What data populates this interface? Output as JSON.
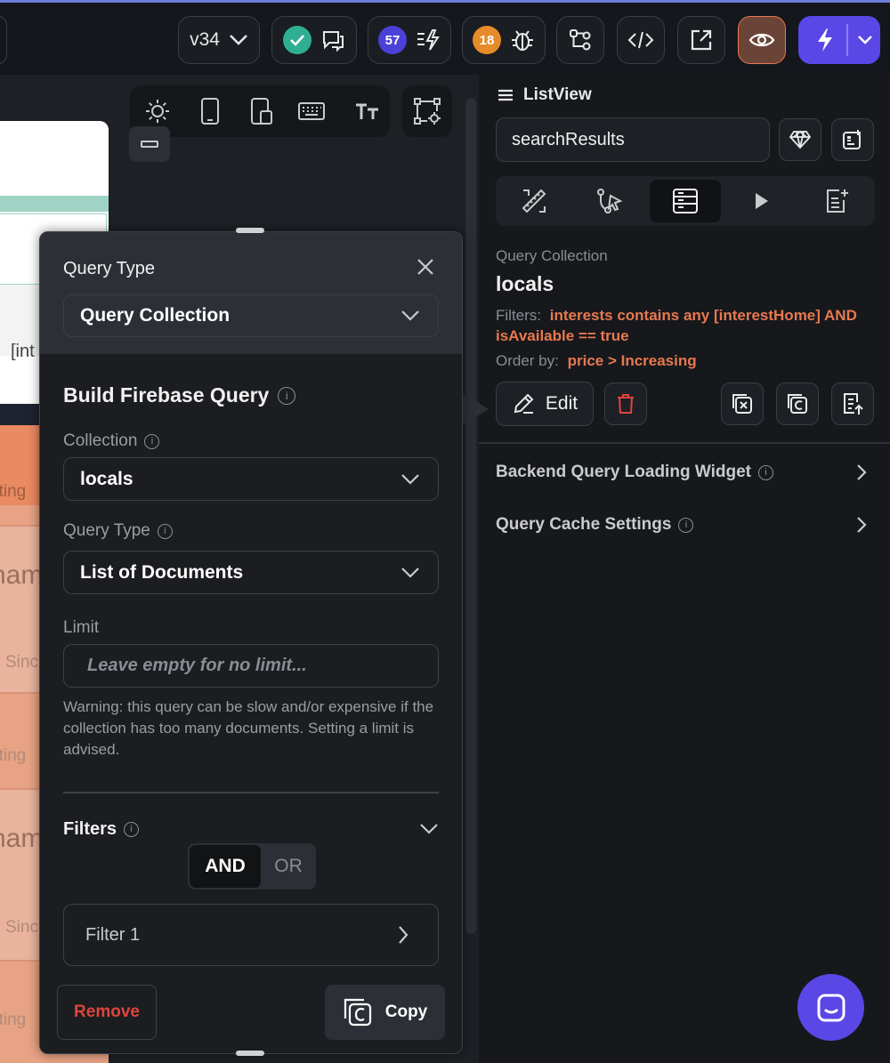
{
  "toolbar": {
    "version": "v34",
    "comments_count": "57",
    "bugs_count": "18",
    "colors": {
      "green": "#2fae93",
      "purple": "#4a42d8",
      "orange": "#e58b2a",
      "lightning": "#5a47e6",
      "eye_bg": "#6b4438"
    }
  },
  "canvas_tools": [
    "sun-icon",
    "phone-icon",
    "tablet-icon",
    "keyboard-icon",
    "text-size-icon",
    "settings-icon"
  ],
  "canvas_bg": {
    "partial_text": [
      "[int",
      "ating",
      "nam",
      "Sinc",
      "ating",
      "nam",
      "Sinc",
      "ating",
      "name"
    ]
  },
  "modal": {
    "header_label": "Query Type",
    "header_value": "Query Collection",
    "section_title": "Build Firebase Query",
    "collection_label": "Collection",
    "collection_value": "locals",
    "query_type_label": "Query Type",
    "query_type_value": "List of Documents",
    "limit_label": "Limit",
    "limit_placeholder": "Leave empty for no limit...",
    "warning": "Warning: this query can be slow and/or expensive if the collection has too many documents. Setting a limit is advised.",
    "filters_label": "Filters",
    "and_label": "AND",
    "or_label": "OR",
    "filter_item": "Filter 1",
    "remove_label": "Remove",
    "copy_label": "Copy"
  },
  "panel": {
    "widget_name": "ListView",
    "search_value": "searchResults",
    "query_label": "Query Collection",
    "collection": "locals",
    "filters_prefix": "Filters:",
    "filters_value_1": "interests contains any [interestHome] AND",
    "filters_value_2": "isAvailable == true",
    "order_prefix": "Order by:",
    "order_value": "price > Increasing",
    "edit_label": "Edit",
    "section_1": "Backend Query Loading Widget",
    "section_2": "Query Cache Settings"
  }
}
